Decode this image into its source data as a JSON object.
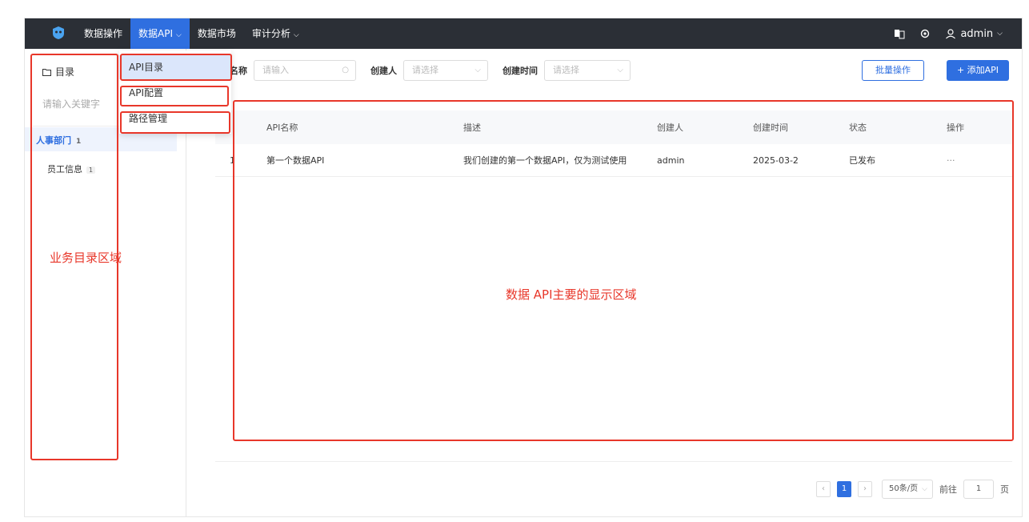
{
  "topbar": {
    "logo": "shield-cat-logo",
    "nav": [
      {
        "label": "数据操作",
        "chevron": false,
        "active": false
      },
      {
        "label": "数据API",
        "chevron": true,
        "active": true
      },
      {
        "label": "数据市场",
        "chevron": false,
        "active": false
      },
      {
        "label": "审计分析",
        "chevron": true,
        "active": false
      }
    ],
    "user": "admin"
  },
  "dropdown": {
    "items": [
      "API目录",
      "API配置",
      "路径管理"
    ]
  },
  "sidebar": {
    "title": "目录",
    "search_placeholder": "请输入关键字",
    "dept": {
      "label": "人事部门",
      "count": "1"
    },
    "child": {
      "label": "员工信息",
      "count": "1"
    }
  },
  "filters": {
    "name_label": "名称",
    "name_placeholder": "请输入",
    "creator_label": "创建人",
    "creator_placeholder": "请选择",
    "time_label": "创建时间",
    "time_placeholder": "请选择"
  },
  "buttons": {
    "batch": "批量操作",
    "add": "+ 添加API"
  },
  "table": {
    "headers": [
      "API名称",
      "描述",
      "创建人",
      "创建时间",
      "状态",
      "操作"
    ],
    "rows": [
      {
        "index": "1",
        "name": "第一个数据API",
        "desc": "我们创建的第一个数据API，仅为测试使用",
        "creator": "admin",
        "time": "2025-03-2",
        "status": "已发布",
        "ops": "···"
      }
    ]
  },
  "pagination": {
    "current": "1",
    "page_size": "50条/页",
    "goto_label": "前往",
    "goto_value": "1",
    "page_suffix": "页"
  },
  "annotations": {
    "sidebar_label": "业务目录区域",
    "main_label": "数据 API主要的显示区域",
    "color": "#e8372a"
  },
  "colors": {
    "topbar": "#2b2f36",
    "accent": "#2f6fe0"
  }
}
